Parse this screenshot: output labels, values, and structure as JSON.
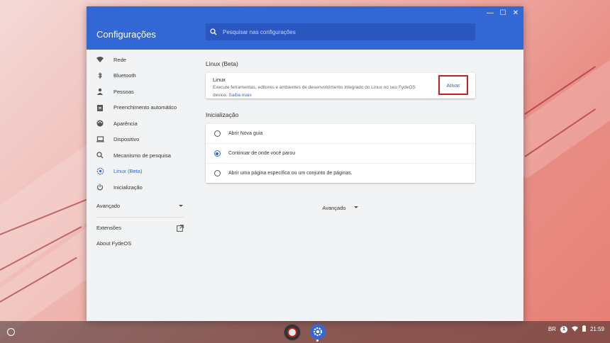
{
  "window": {
    "title": "Configurações",
    "controls": {
      "minimize": "—",
      "maximize": "☐",
      "close": "✕"
    }
  },
  "search": {
    "placeholder": "Pesquisar nas configurações"
  },
  "sidebar": {
    "items": [
      {
        "label": "Rede",
        "icon": "wifi-icon"
      },
      {
        "label": "Bluetooth",
        "icon": "bluetooth-icon"
      },
      {
        "label": "Pessoas",
        "icon": "person-icon"
      },
      {
        "label": "Preenchimento automático",
        "icon": "clipboard-icon"
      },
      {
        "label": "Aparência",
        "icon": "palette-icon"
      },
      {
        "label": "Dispositivo",
        "icon": "laptop-icon"
      },
      {
        "label": "Mecanismo de pesquisa",
        "icon": "search-icon"
      },
      {
        "label": "Linux (Beta)",
        "icon": "linux-gear-icon",
        "active": true
      },
      {
        "label": "Inicialização",
        "icon": "power-icon"
      }
    ],
    "advanced_label": "Avançado",
    "extensions_label": "Extensões",
    "about_label": "About FydeOS"
  },
  "main": {
    "linux": {
      "section_title": "Linux (Beta)",
      "name": "Linux",
      "description": "Execute ferramentas, editores e ambientes de desenvolvimento integrado do Linux no seu FydeOS device.",
      "learn_more": "Saiba mais",
      "activate_label": "Ativar"
    },
    "startup": {
      "section_title": "Inicialização",
      "options": [
        {
          "label": "Abrir Nova guia",
          "selected": false
        },
        {
          "label": "Continuar de onde você parou",
          "selected": true
        },
        {
          "label": "Abrir uma página específica ou um conjunto de páginas.",
          "selected": false
        }
      ]
    },
    "advanced_label": "Avançado"
  },
  "shelf": {
    "locale": "BR",
    "notification_count": "1",
    "time": "21:59"
  },
  "colors": {
    "accent": "#3367d6",
    "highlight": "#cc1e25"
  }
}
